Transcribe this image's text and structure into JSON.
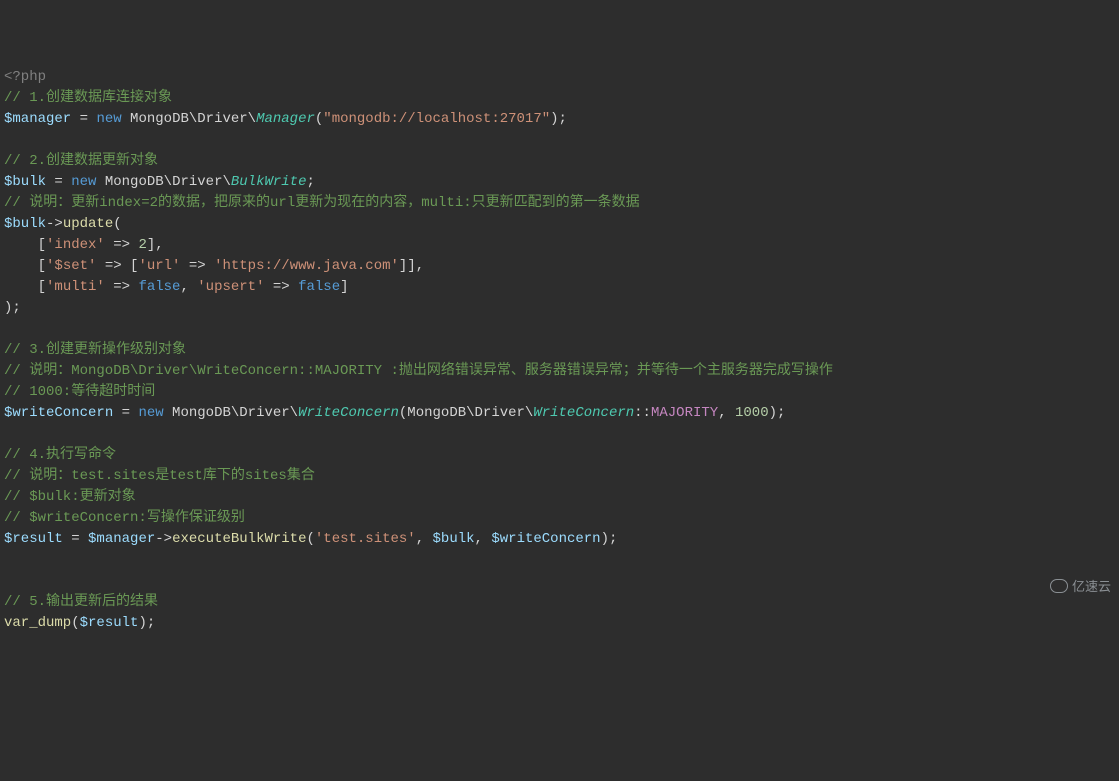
{
  "line01_phptag": "<?php",
  "line02_comment": "// 1.创建数据库连接对象",
  "line03_var": "$manager",
  "line03_eq": " = ",
  "line03_new": "new",
  "line03_ns": " MongoDB\\Driver\\",
  "line03_class": "Manager",
  "line03_open": "(",
  "line03_str": "\"mongodb://localhost:27017\"",
  "line03_close": ");",
  "line05_comment": "// 2.创建数据更新对象",
  "line06_var": "$bulk",
  "line06_eq": " = ",
  "line06_new": "new",
  "line06_ns": " MongoDB\\Driver\\",
  "line06_class": "BulkWrite",
  "line06_semi": ";",
  "line07_comment": "// 说明：更新index=2的数据，把原来的url更新为现在的内容，multi:只更新匹配到的第一条数据",
  "line08_var": "$bulk",
  "line08_arrow": "->",
  "line08_method": "update",
  "line08_open": "(",
  "line09_indent": "    [",
  "line09_str1": "'index'",
  "line09_fat": " => ",
  "line09_num": "2",
  "line09_close": "],",
  "line10_indent": "    [",
  "line10_s1": "'$set'",
  "line10_fat1": " => [",
  "line10_s2": "'url'",
  "line10_fat2": " => ",
  "line10_s3": "'https://www.java.com'",
  "line10_close": "]],",
  "line11_indent": "    [",
  "line11_s1": "'multi'",
  "line11_fat1": " => ",
  "line11_false1": "false",
  "line11_comma": ", ",
  "line11_s2": "'upsert'",
  "line11_fat2": " => ",
  "line11_false2": "false",
  "line11_close": "]",
  "line12_close": ");",
  "line14_comment": "// 3.创建更新操作级别对象",
  "line15_comment": "// 说明：MongoDB\\Driver\\WriteConcern::MAJORITY :抛出网络错误异常、服务器错误异常；并等待一个主服务器完成写操作",
  "line16_comment": "// 1000:等待超时时间",
  "line17_var": "$writeConcern",
  "line17_eq": " = ",
  "line17_new": "new",
  "line17_ns1": " MongoDB\\Driver\\",
  "line17_class1": "WriteConcern",
  "line17_open": "(MongoDB\\Driver\\",
  "line17_class2": "WriteConcern",
  "line17_scope": "::",
  "line17_const": "MAJORITY",
  "line17_comma": ", ",
  "line17_num": "1000",
  "line17_close": ");",
  "line19_comment": "// 4.执行写命令",
  "line20_comment": "// 说明：test.sites是test库下的sites集合",
  "line21_comment": "// $bulk:更新对象",
  "line22_comment": "// $writeConcern:写操作保证级别",
  "line23_var1": "$result",
  "line23_eq": " = ",
  "line23_var2": "$manager",
  "line23_arrow": "->",
  "line23_method": "executeBulkWrite",
  "line23_open": "(",
  "line23_s1": "'test.sites'",
  "line23_c1": ", ",
  "line23_var3": "$bulk",
  "line23_c2": ", ",
  "line23_var4": "$writeConcern",
  "line23_close": ");",
  "line26_comment": "// 5.输出更新后的结果",
  "line27_fn": "var_dump",
  "line27_open": "(",
  "line27_var": "$result",
  "line27_close": ");",
  "watermark_text": "亿速云"
}
